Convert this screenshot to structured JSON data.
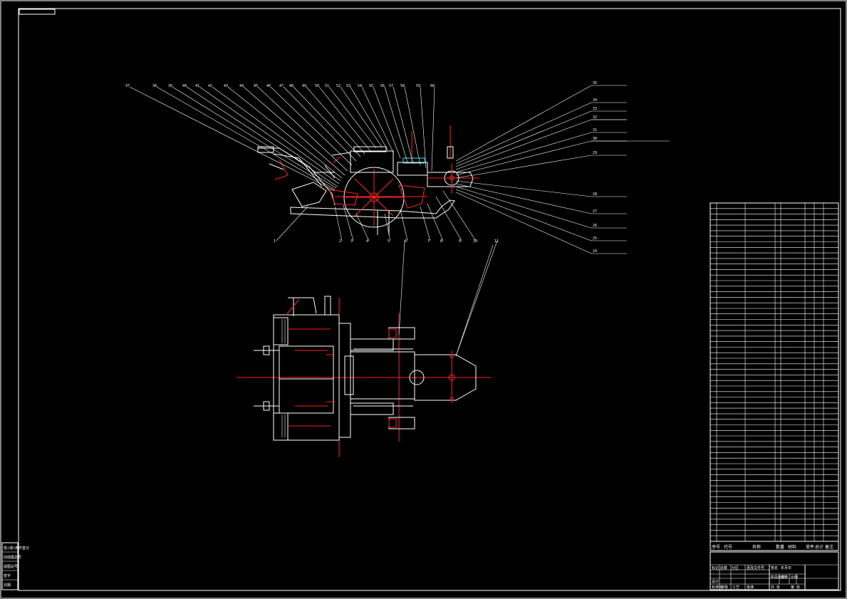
{
  "drawing": {
    "colors": {
      "background": "#000000",
      "line": "#ffffff",
      "center_line": "#ff2020",
      "accent": "#40e0ff"
    }
  },
  "balloons": {
    "top_row": [
      "37",
      "38",
      "39",
      "40",
      "41",
      "42",
      "43",
      "44",
      "45",
      "46",
      "47",
      "48",
      "49",
      "50",
      "51",
      "52",
      "53",
      "54",
      "55",
      "56",
      "57",
      "58",
      "59",
      "60"
    ],
    "right_side": [
      "35",
      "34",
      "33",
      "32",
      "31",
      "30",
      "29",
      "28",
      "27",
      "26",
      "25",
      "24",
      "23",
      "22",
      "21",
      "20",
      "19"
    ],
    "bottom_row": [
      "1",
      "2",
      "3",
      "4",
      "5",
      "6",
      "7",
      "8",
      "9",
      "10",
      "11",
      "12",
      "13",
      "14",
      "15",
      "16",
      "17",
      "18"
    ]
  },
  "parts_list": {
    "rows": 61,
    "header": [
      "序号",
      "代号",
      "名称",
      "数量",
      "材料",
      "单件",
      "总计",
      "备注"
    ]
  },
  "title_block": {
    "labels": [
      "标记",
      "处数",
      "分区",
      "更改文件号",
      "签名",
      "年月日",
      "设计",
      "标准化",
      "阶段标记",
      "重量",
      "比例",
      "审核",
      "工艺",
      "批准",
      "共 张",
      "第 张"
    ]
  },
  "side_stamp": {
    "labels": [
      "借(通)用件登记",
      "旧底图总号",
      "底图总号",
      "签字",
      "日期"
    ]
  }
}
